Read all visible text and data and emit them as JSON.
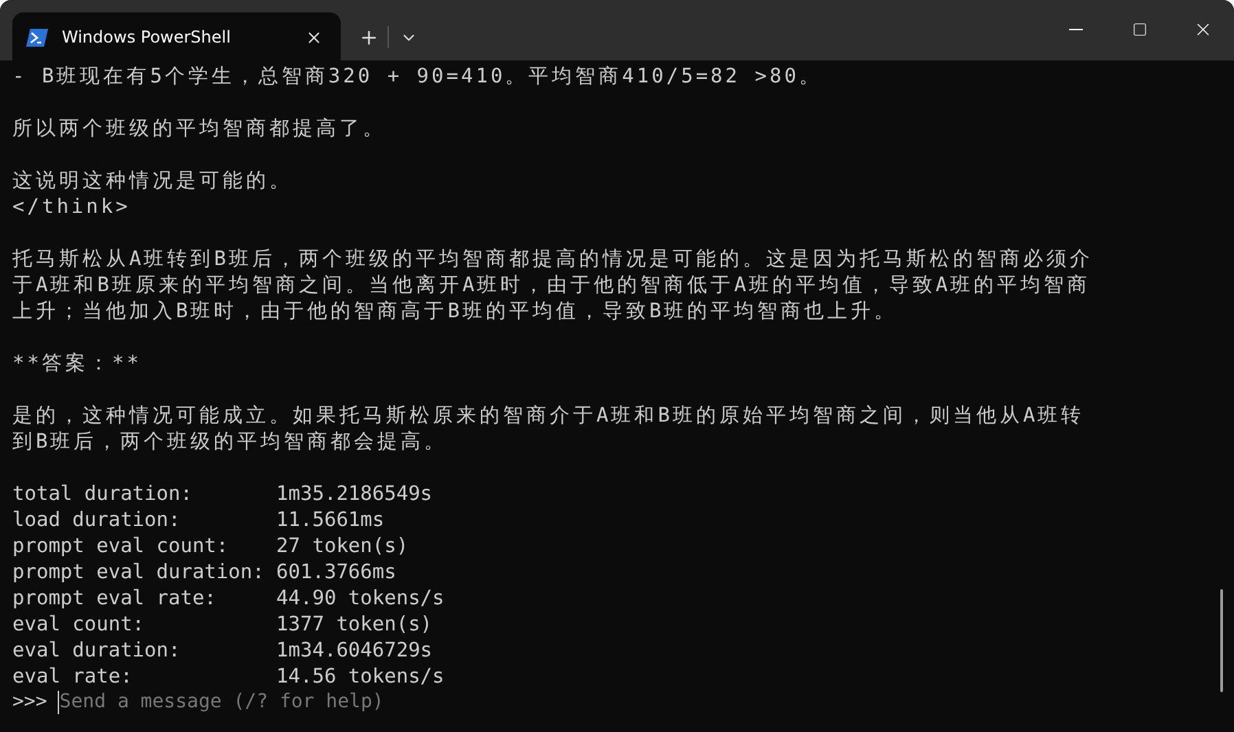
{
  "tabs": [
    {
      "label": "Windows PowerShell",
      "selected": true
    }
  ],
  "terminal": {
    "blocks": [
      {
        "kind": "prose",
        "lines": [
          "- B班现在有5个学生，总智商320 + 90=410。平均智商410/5=82 >80。"
        ]
      },
      {
        "kind": "prose",
        "lines": [
          "所以两个班级的平均智商都提高了。"
        ]
      },
      {
        "kind": "prose",
        "lines": [
          "这说明这种情况是可能的。",
          "</think>"
        ]
      },
      {
        "kind": "prose",
        "lines": [
          "托马斯松从A班转到B班后，两个班级的平均智商都提高的情况是可能的。这是因为托马斯松的智商必须介",
          "于A班和B班原来的平均智商之间。当他离开A班时，由于他的智商低于A班的平均值，导致A班的平均智商",
          "上升；当他加入B班时，由于他的智商高于B班的平均值，导致B班的平均智商也上升。"
        ]
      },
      {
        "kind": "prose",
        "lines": [
          "**答案：**"
        ]
      },
      {
        "kind": "prose",
        "lines": [
          "是的，这种情况可能成立。如果托马斯松原来的智商介于A班和B班的原始平均智商之间，则当他从A班转",
          "到B班后，两个班级的平均智商都会提高。"
        ]
      },
      {
        "kind": "stats",
        "lines": [
          "total duration:       1m35.2186549s",
          "load duration:        11.5661ms",
          "prompt eval count:    27 token(s)",
          "prompt eval duration: 601.3766ms",
          "prompt eval rate:     44.90 tokens/s",
          "eval count:           1377 token(s)",
          "eval duration:        1m34.6046729s",
          "eval rate:            14.56 tokens/s"
        ]
      }
    ],
    "prompt": {
      "symbol": ">>>",
      "placeholder": "Send a message (/? for help)"
    }
  }
}
